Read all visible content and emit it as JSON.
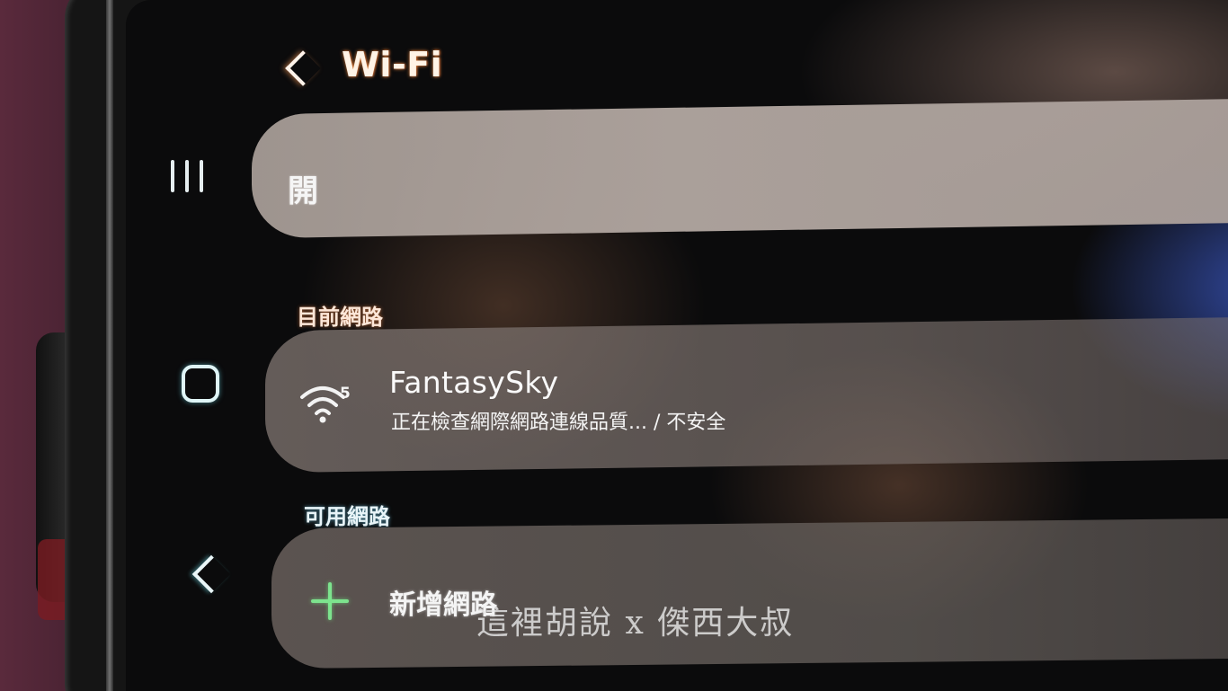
{
  "header": {
    "title": "Wi-Fi",
    "back_icon": "chevron-left-icon"
  },
  "toggle": {
    "label": "開"
  },
  "sections": {
    "current_label": "目前網路",
    "available_label": "可用網路"
  },
  "current_network": {
    "name": "FantasySky",
    "status": "正在檢查網際網路連線品質... / 不安全",
    "wifi_standard_badge": "5",
    "icon": "wifi-icon"
  },
  "add_network": {
    "label": "新增網路",
    "icon": "plus-icon"
  },
  "nav_bar": {
    "recents_icon": "recents-icon",
    "home_icon": "home-icon",
    "back_icon": "back-icon"
  },
  "watermark": {
    "text": "這裡胡說 x 傑西大叔"
  },
  "colors": {
    "accent_plus": "#7de38e",
    "title_glow": "#ff9646",
    "background": "#0b0b0c"
  }
}
